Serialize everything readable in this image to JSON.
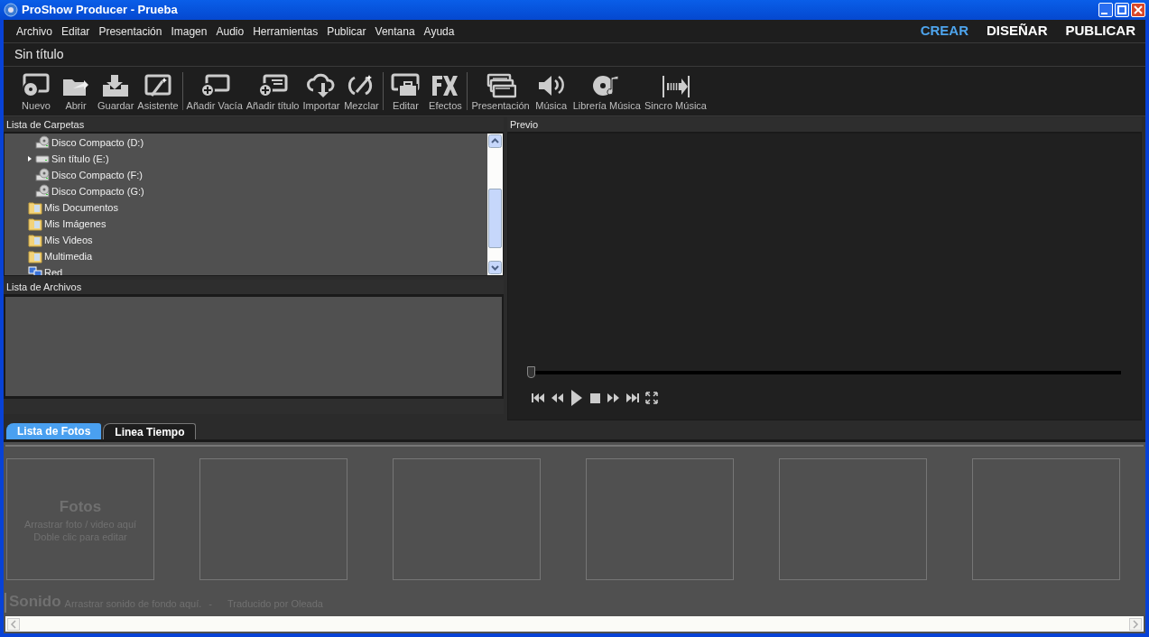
{
  "window": {
    "title": "ProShow Producer - Prueba"
  },
  "menu": [
    "Archivo",
    "Editar",
    "Presentación",
    "Imagen",
    "Audio",
    "Herramientas",
    "Publicar",
    "Ventana",
    "Ayuda"
  ],
  "modes": [
    {
      "label": "CREAR",
      "selected": true
    },
    {
      "label": "DISEÑAR",
      "selected": false
    },
    {
      "label": "PUBLICAR",
      "selected": false
    }
  ],
  "project_title": "Sin título",
  "toolbar": [
    [
      {
        "label": "Nuevo"
      },
      {
        "label": "Abrir"
      },
      {
        "label": "Guardar"
      },
      {
        "label": "Asistente"
      }
    ],
    [
      {
        "label": "Añadir Vacía"
      },
      {
        "label": "Añadir título"
      },
      {
        "label": "Importar"
      },
      {
        "label": "Mezclar"
      }
    ],
    [
      {
        "label": "Editar"
      },
      {
        "label": "Efectos"
      }
    ],
    [
      {
        "label": "Presentación"
      },
      {
        "label": "Música"
      },
      {
        "label": "Librería Música"
      },
      {
        "label": "Sincro Música"
      }
    ]
  ],
  "folders": {
    "title": "Lista de Carpetas",
    "items": [
      {
        "label": "Disco Compacto (D:)",
        "kind": "cd-drive",
        "expandable": false
      },
      {
        "label": "Sin título (E:)",
        "kind": "drive",
        "expandable": true
      },
      {
        "label": "Disco Compacto (F:)",
        "kind": "cd-drive",
        "expandable": false
      },
      {
        "label": "Disco Compacto (G:)",
        "kind": "cd-drive",
        "expandable": false
      },
      {
        "label": "Mis Documentos",
        "kind": "folder",
        "expandable": false
      },
      {
        "label": "Mis Imágenes",
        "kind": "folder",
        "expandable": false
      },
      {
        "label": "Mis Videos",
        "kind": "folder",
        "expandable": false
      },
      {
        "label": "Multimedia",
        "kind": "folder",
        "expandable": false
      },
      {
        "label": "Red",
        "kind": "network",
        "expandable": false
      }
    ]
  },
  "files": {
    "title": "Lista de Archivos"
  },
  "preview": {
    "title": "Previo",
    "position": {
      "level": 0
    }
  },
  "bottom_tabs": [
    {
      "label": "Lista de Fotos",
      "selected": true
    },
    {
      "label": "Linea Tiempo",
      "selected": false
    }
  ],
  "slides": [
    {
      "kind": "drop-target",
      "title": "Fotos",
      "lines": [
        "Arrastrar foto / video aquí",
        "Doble clic para editar"
      ]
    },
    {
      "kind": "empty"
    },
    {
      "kind": "empty"
    },
    {
      "kind": "empty"
    },
    {
      "kind": "empty"
    },
    {
      "kind": "empty"
    }
  ],
  "sound": {
    "title": "Sonido",
    "hint": "Arrastrar sonido de fondo aquí.",
    "separator": "-",
    "credit": "Traducido por Oleada"
  }
}
